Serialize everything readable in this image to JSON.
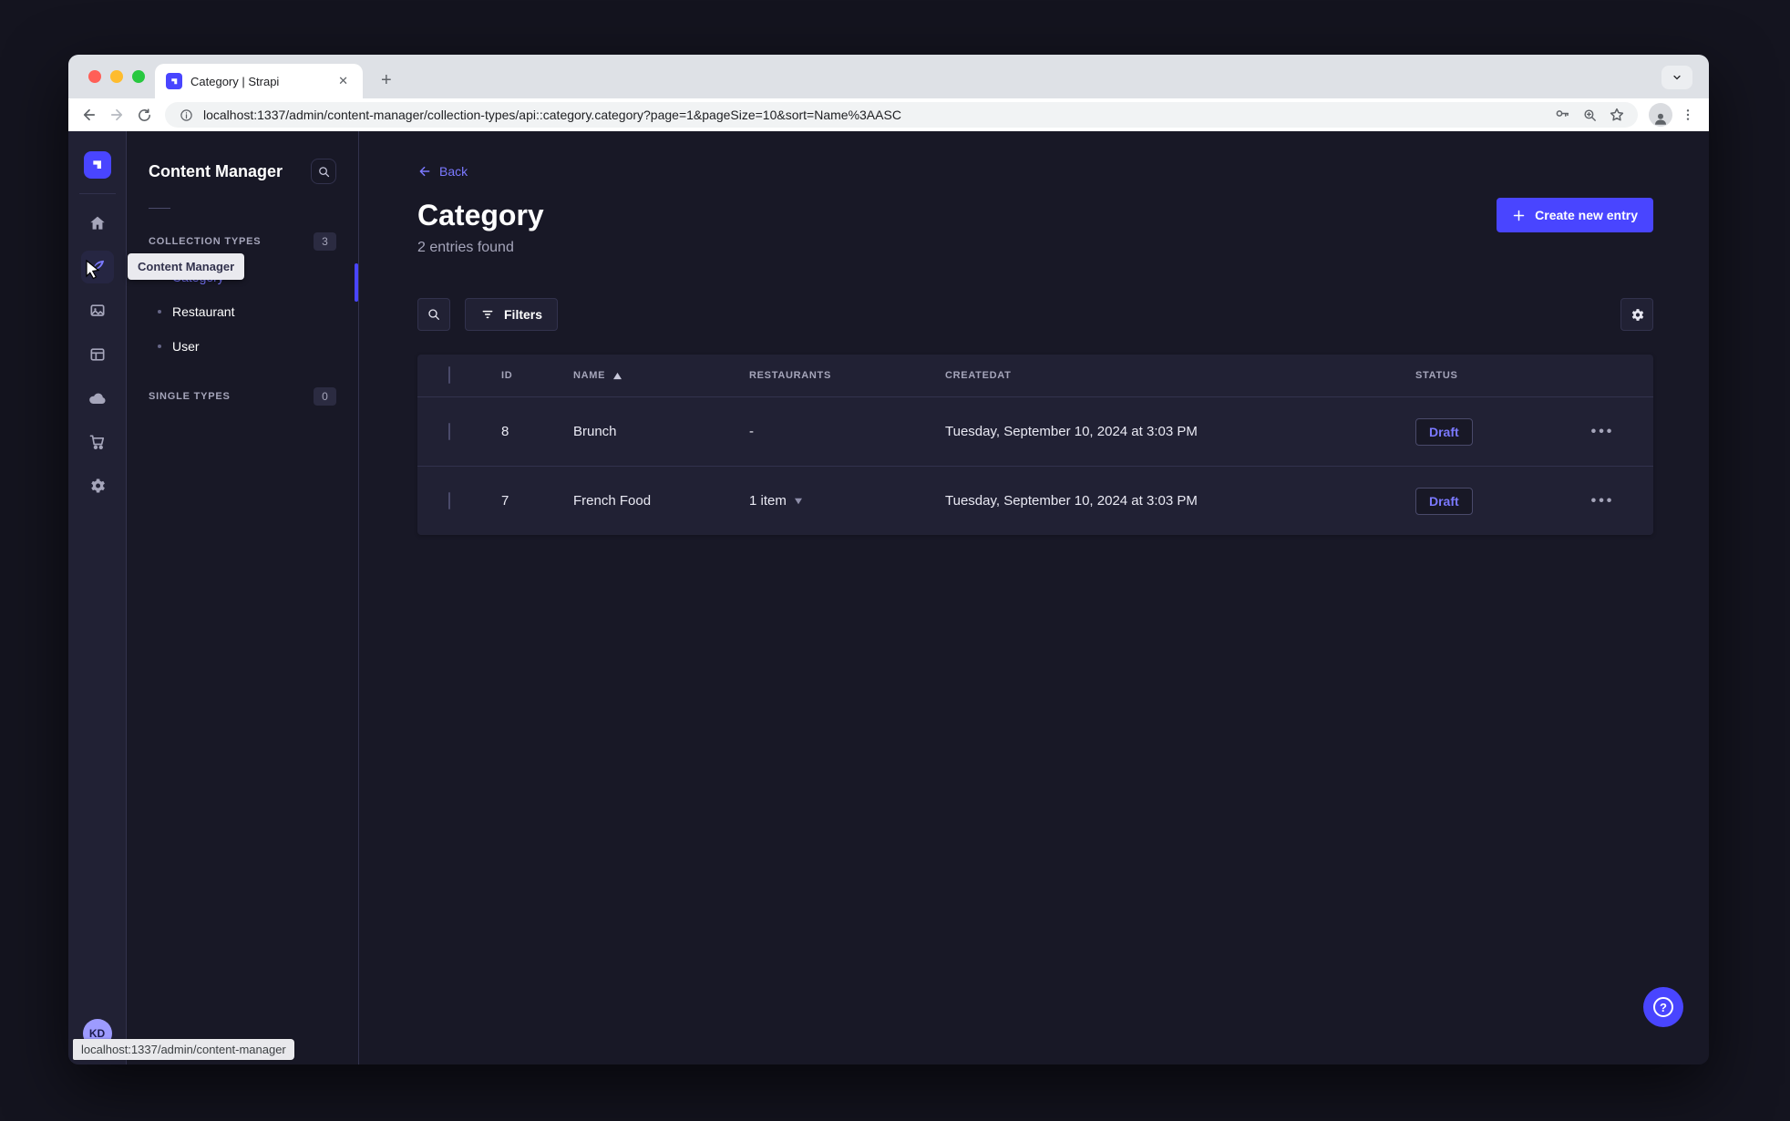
{
  "browser": {
    "tab_title": "Category | Strapi",
    "url": "localhost:1337/admin/content-manager/collection-types/api::category.category?page=1&pageSize=10&sort=Name%3AASC",
    "status_link": "localhost:1337/admin/content-manager"
  },
  "panel": {
    "title": "Content Manager",
    "tooltip": "Content Manager",
    "sections": [
      {
        "label": "COLLECTION TYPES",
        "count": "3",
        "items": [
          {
            "label": "Category",
            "active": true
          },
          {
            "label": "Restaurant",
            "active": false
          },
          {
            "label": "User",
            "active": false
          }
        ]
      },
      {
        "label": "SINGLE TYPES",
        "count": "0",
        "items": []
      }
    ]
  },
  "main": {
    "back_label": "Back",
    "title": "Category",
    "subtitle": "2 entries found",
    "create_button": "Create new entry",
    "filters_button": "Filters"
  },
  "table": {
    "headers": [
      "ID",
      "NAME",
      "RESTAURANTS",
      "CREATEDAT",
      "STATUS"
    ],
    "rows": [
      {
        "id": "8",
        "name": "Brunch",
        "restaurants": "-",
        "createdAt": "Tuesday, September 10, 2024 at 3:03 PM",
        "status": "Draft"
      },
      {
        "id": "7",
        "name": "French Food",
        "restaurants": "1 item",
        "createdAt": "Tuesday, September 10, 2024 at 3:03 PM",
        "status": "Draft"
      }
    ]
  },
  "user": {
    "initials": "KD"
  },
  "colors": {
    "accent": "#4945ff",
    "accent_light": "#7b79ff",
    "background": "#181826",
    "surface": "#212134",
    "border": "#32324d",
    "muted_text": "#a5a5ba"
  }
}
